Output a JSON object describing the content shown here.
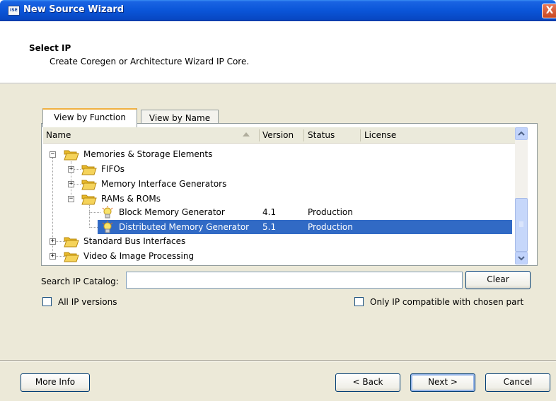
{
  "window": {
    "title": "New Source Wizard",
    "close_glyph": "X",
    "icon_text": "ISE"
  },
  "header": {
    "title": "Select IP",
    "subtitle": "Create Coregen or Architecture Wizard IP Core."
  },
  "tabs": [
    {
      "label": "View by Function",
      "active": true
    },
    {
      "label": "View by Name",
      "active": false
    }
  ],
  "columns": [
    "Name",
    "Version",
    "Status",
    "License"
  ],
  "tree": [
    {
      "label": "Memories & Storage Elements",
      "version": "",
      "status": "",
      "license": "",
      "expanded": true,
      "type": "folder",
      "toggle": "−"
    },
    {
      "label": "FIFOs",
      "version": "",
      "status": "",
      "license": "",
      "expanded": false,
      "type": "folder",
      "toggle": "+"
    },
    {
      "label": "Memory Interface Generators",
      "version": "",
      "status": "",
      "license": "",
      "expanded": false,
      "type": "folder",
      "toggle": "+"
    },
    {
      "label": "RAMs & ROMs",
      "version": "",
      "status": "",
      "license": "",
      "expanded": true,
      "type": "folder",
      "toggle": "−"
    },
    {
      "label": "Block Memory Generator",
      "version": "4.1",
      "status": "Production",
      "license": "",
      "type": "core"
    },
    {
      "label": "Distributed Memory Generator",
      "version": "5.1",
      "status": "Production",
      "license": "",
      "type": "core",
      "selected": true
    },
    {
      "label": "Standard Bus Interfaces",
      "version": "",
      "status": "",
      "license": "",
      "expanded": false,
      "type": "folder",
      "toggle": "+"
    },
    {
      "label": "Video & Image Processing",
      "version": "",
      "status": "",
      "license": "",
      "expanded": false,
      "type": "folder",
      "toggle": "+"
    }
  ],
  "search": {
    "label": "Search IP Catalog:",
    "value": "",
    "placeholder": "",
    "clear_label": "Clear"
  },
  "options": {
    "all_versions_label": "All IP versions",
    "all_versions_checked": false,
    "compatible_label": "Only IP compatible with chosen part",
    "compatible_checked": false
  },
  "buttons": {
    "more_info": "More Info",
    "back": "< Back",
    "next": "Next >",
    "cancel": "Cancel"
  },
  "icons": {
    "folder": "folder-icon",
    "core": "ip-core-icon",
    "expand": "expand-icon",
    "collapse": "collapse-icon"
  },
  "colors": {
    "title_bar": "#0a55d8",
    "selection": "#316ac5",
    "dialog_bg": "#ece9d8",
    "folder": "#f5d35a"
  }
}
